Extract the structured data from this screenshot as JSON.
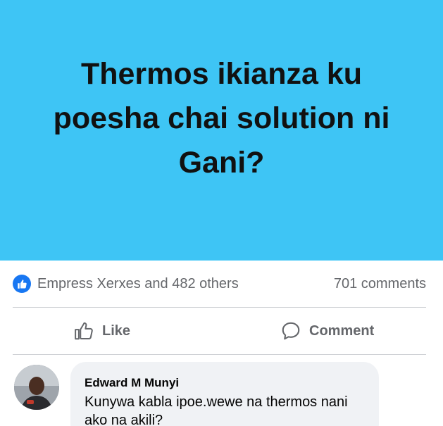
{
  "post": {
    "text": "Thermos ikianza ku poesha chai solution ni Gani?",
    "background_color": "#3ec5f5"
  },
  "reactions": {
    "icon": "like-icon",
    "summary": "Empress Xerxes and 482 others",
    "comments_count": "701 comments"
  },
  "actions": {
    "like_label": "Like",
    "like_icon": "thumbs-up-icon",
    "comment_label": "Comment",
    "comment_icon": "speech-bubble-icon"
  },
  "comment": {
    "author": "Edward M Munyi",
    "text": "Kunywa kabla ipoe.wewe na thermos nani ako na akili?"
  },
  "colors": {
    "accent": "#1877f2",
    "secondary_text": "#65676b",
    "bubble": "#f0f2f5"
  }
}
